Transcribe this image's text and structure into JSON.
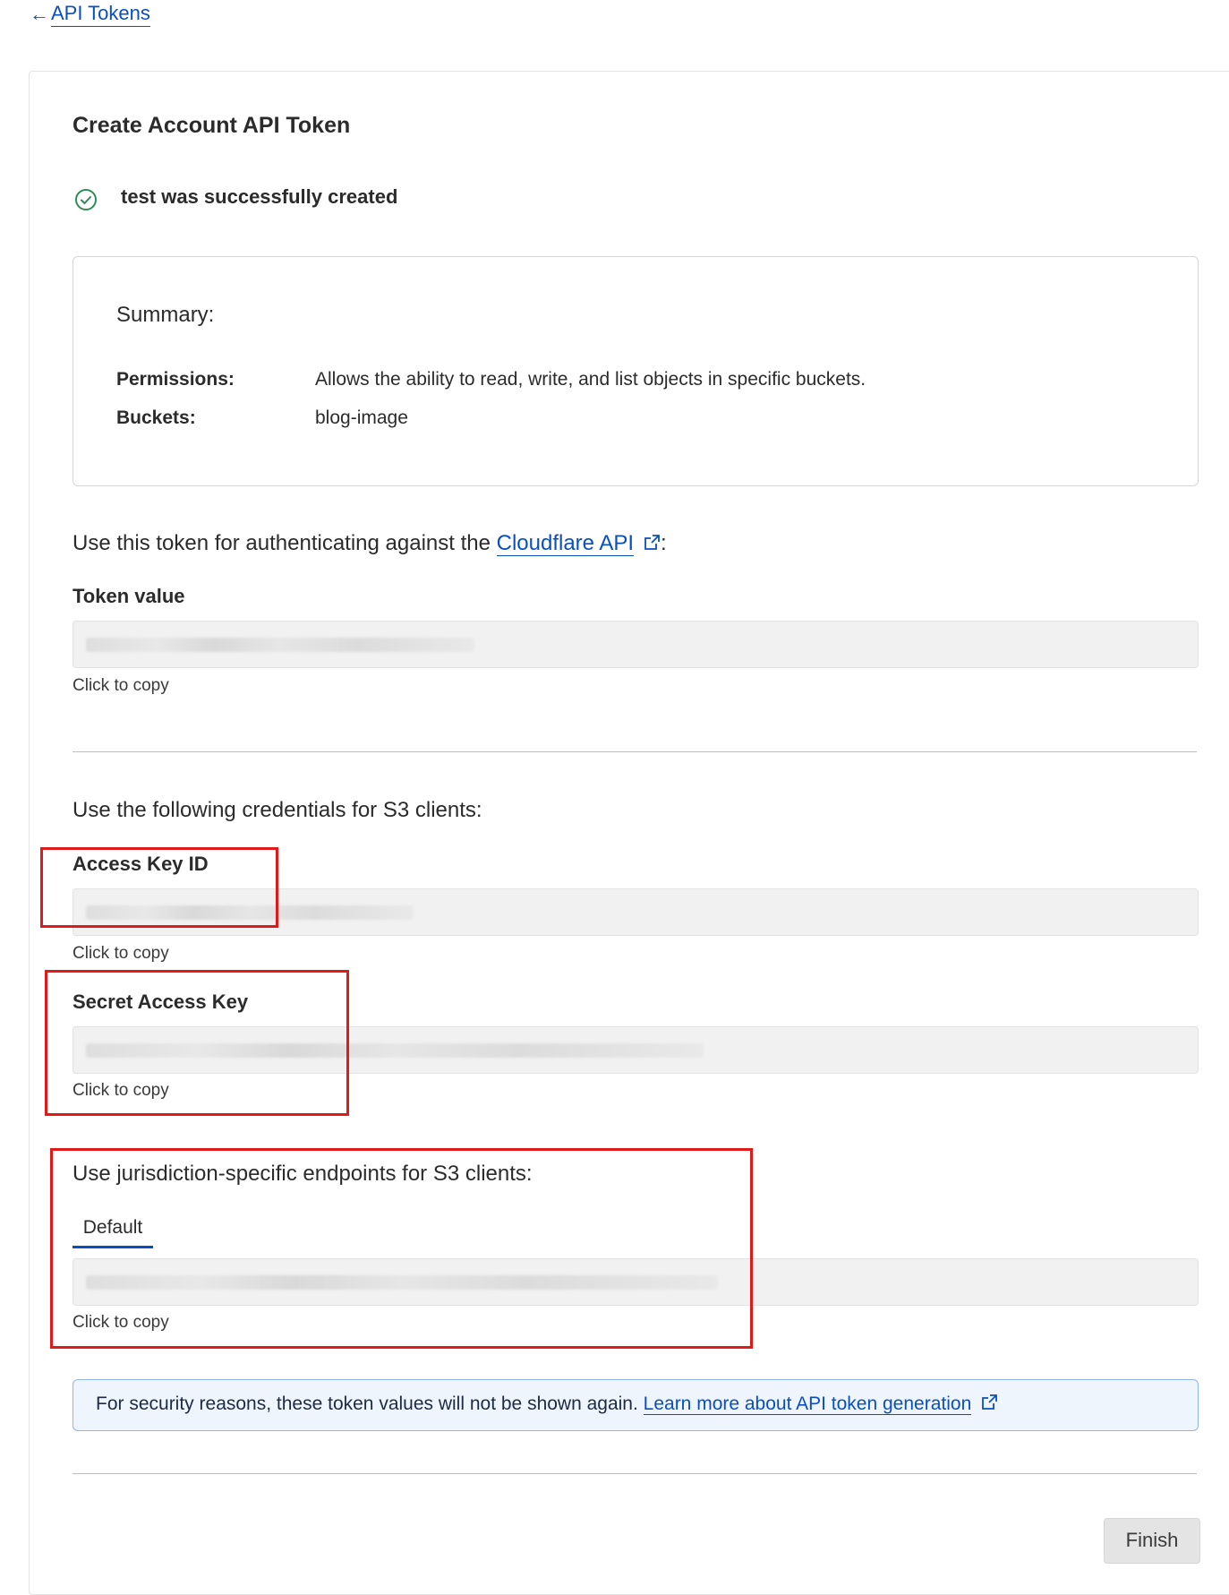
{
  "nav": {
    "back_label": "API Tokens"
  },
  "page": {
    "title": "Create Account API Token"
  },
  "status": {
    "message": "test was successfully created",
    "color": "#2e8b57"
  },
  "summary": {
    "title": "Summary:",
    "rows": [
      {
        "key": "Permissions:",
        "value": "Allows the ability to read, write, and list objects in specific buckets."
      },
      {
        "key": "Buckets:",
        "value": "blog-image"
      }
    ]
  },
  "token_section": {
    "intro_prefix": "Use this token for authenticating against the ",
    "intro_link": "Cloudflare API",
    "intro_suffix": ":",
    "label": "Token value",
    "copy_hint": "Click to copy"
  },
  "s3_section": {
    "intro": "Use the following credentials for S3 clients:",
    "access_key_label": "Access Key ID",
    "access_key_hint": "Click to copy",
    "secret_key_label": "Secret Access Key",
    "secret_key_hint": "Click to copy"
  },
  "endpoints_section": {
    "intro": "Use jurisdiction-specific endpoints for S3 clients:",
    "tab_label": "Default",
    "copy_hint": "Click to copy"
  },
  "notice": {
    "text": "For security reasons, these token values will not be shown again. ",
    "link": "Learn more about API token generation"
  },
  "footer": {
    "finish_label": "Finish"
  },
  "colors": {
    "link": "#0a4fbf",
    "annotation_red": "#e01a1a",
    "notice_bg": "#eef5fd"
  }
}
